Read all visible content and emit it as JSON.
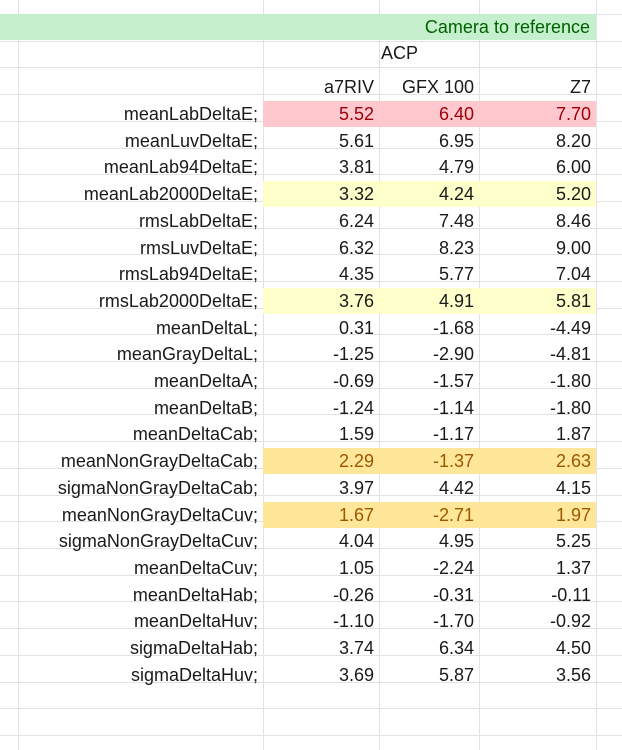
{
  "sheet": {
    "banner": "Camera to reference",
    "group_header": "ACP",
    "col_headers": [
      "a7RIV",
      "GFX 100",
      "Z7"
    ],
    "rows": [
      {
        "label": "meanLabDeltaE;",
        "values": [
          "5.52",
          "6.40",
          "7.70"
        ],
        "fill": "pink"
      },
      {
        "label": "meanLuvDeltaE;",
        "values": [
          "5.61",
          "6.95",
          "8.20"
        ],
        "fill": ""
      },
      {
        "label": "meanLab94DeltaE;",
        "values": [
          "3.81",
          "4.79",
          "6.00"
        ],
        "fill": ""
      },
      {
        "label": "meanLab2000DeltaE;",
        "values": [
          "3.32",
          "4.24",
          "5.20"
        ],
        "fill": "yellow"
      },
      {
        "label": "rmsLabDeltaE;",
        "values": [
          "6.24",
          "7.48",
          "8.46"
        ],
        "fill": ""
      },
      {
        "label": "rmsLuvDeltaE;",
        "values": [
          "6.32",
          "8.23",
          "9.00"
        ],
        "fill": ""
      },
      {
        "label": "rmsLab94DeltaE;",
        "values": [
          "4.35",
          "5.77",
          "7.04"
        ],
        "fill": ""
      },
      {
        "label": "rmsLab2000DeltaE;",
        "values": [
          "3.76",
          "4.91",
          "5.81"
        ],
        "fill": "yellow"
      },
      {
        "label": "meanDeltaL;",
        "values": [
          "0.31",
          "-1.68",
          "-4.49"
        ],
        "fill": ""
      },
      {
        "label": "meanGrayDeltaL;",
        "values": [
          "-1.25",
          "-2.90",
          "-4.81"
        ],
        "fill": ""
      },
      {
        "label": "meanDeltaA;",
        "values": [
          "-0.69",
          "-1.57",
          "-1.80"
        ],
        "fill": ""
      },
      {
        "label": "meanDeltaB;",
        "values": [
          "-1.24",
          "-1.14",
          "-1.80"
        ],
        "fill": ""
      },
      {
        "label": "meanDeltaCab;",
        "values": [
          "1.59",
          "-1.17",
          "1.87"
        ],
        "fill": ""
      },
      {
        "label": "meanNonGrayDeltaCab;",
        "values": [
          "2.29",
          "-1.37",
          "2.63"
        ],
        "fill": "orange"
      },
      {
        "label": "sigmaNonGrayDeltaCab;",
        "values": [
          "3.97",
          "4.42",
          "4.15"
        ],
        "fill": ""
      },
      {
        "label": "meanNonGrayDeltaCuv;",
        "values": [
          "1.67",
          "-2.71",
          "1.97"
        ],
        "fill": "orange"
      },
      {
        "label": "sigmaNonGrayDeltaCuv;",
        "values": [
          "4.04",
          "4.95",
          "5.25"
        ],
        "fill": ""
      },
      {
        "label": "meanDeltaCuv;",
        "values": [
          "1.05",
          "-2.24",
          "1.37"
        ],
        "fill": ""
      },
      {
        "label": "meanDeltaHab;",
        "values": [
          "-0.26",
          "-0.31",
          "-0.11"
        ],
        "fill": ""
      },
      {
        "label": "meanDeltaHuv;",
        "values": [
          "-1.10",
          "-1.70",
          "-0.92"
        ],
        "fill": ""
      },
      {
        "label": "sigmaDeltaHab;",
        "values": [
          "3.74",
          "6.34",
          "4.50"
        ],
        "fill": ""
      },
      {
        "label": "sigmaDeltaHuv;",
        "values": [
          "3.69",
          "5.87",
          "3.56"
        ],
        "fill": ""
      }
    ]
  },
  "colors": {
    "pink_fill": "#ffc7ce",
    "pink_text": "#9c0006",
    "yellow_fill": "#ffffcc",
    "orange_fill": "#ffe699",
    "orange_text": "#9c5700",
    "green_fill": "#c6efce",
    "green_text": "#006100",
    "gridline": "#e2e2e2"
  }
}
